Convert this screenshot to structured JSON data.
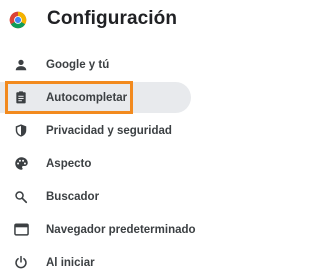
{
  "header": {
    "title": "Configuración",
    "logo_icon": "chrome-logo-icon"
  },
  "menu": {
    "active_index": 1,
    "highlight_color": "#f28a1e",
    "items": [
      {
        "label": "Google y tú",
        "icon": "person-icon"
      },
      {
        "label": "Autocompletar",
        "icon": "clipboard-icon"
      },
      {
        "label": "Privacidad y seguridad",
        "icon": "shield-icon"
      },
      {
        "label": "Aspecto",
        "icon": "palette-icon"
      },
      {
        "label": "Buscador",
        "icon": "search-icon"
      },
      {
        "label": "Navegador predeterminado",
        "icon": "browser-window-icon"
      },
      {
        "label": "Al iniciar",
        "icon": "power-icon"
      }
    ]
  }
}
